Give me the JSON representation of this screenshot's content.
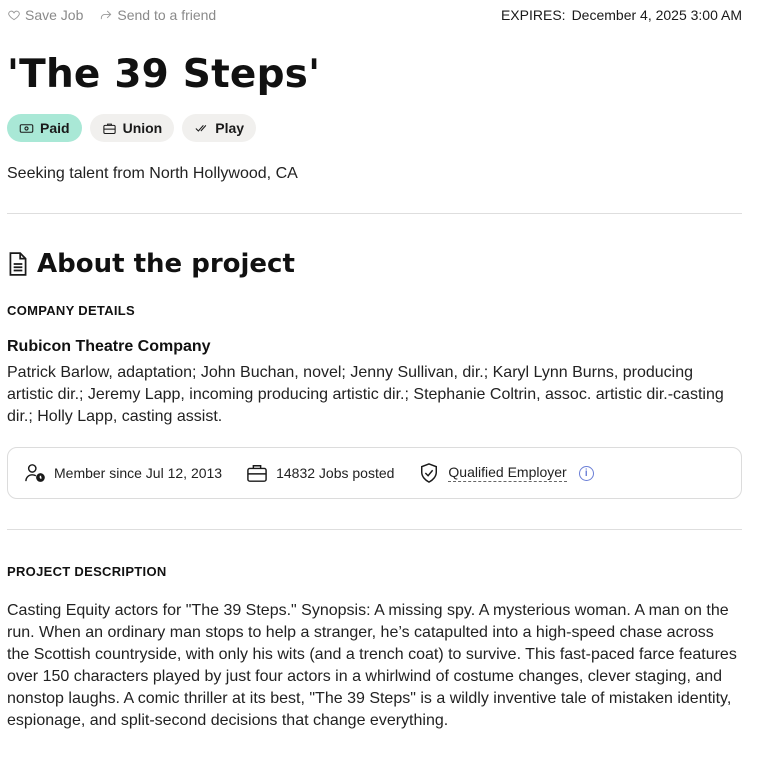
{
  "topbar": {
    "save_job": "Save Job",
    "send_friend": "Send to a friend",
    "expires_label": "EXPIRES:",
    "expires_value": "December 4, 2025 3:00 AM"
  },
  "title": "'The 39 Steps'",
  "tags": [
    {
      "label": "Paid",
      "icon": "cash-icon"
    },
    {
      "label": "Union",
      "icon": "briefcase-icon"
    },
    {
      "label": "Play",
      "icon": "check-icon"
    }
  ],
  "seeking": "Seeking talent from North Hollywood, CA",
  "about": {
    "heading": "About the project",
    "company_details_label": "COMPANY DETAILS",
    "company_name": "Rubicon Theatre Company",
    "company_text": "Patrick Barlow, adaptation; John Buchan, novel; Jenny Sullivan, dir.; Karyl Lynn Burns, producing artistic dir.; Jeremy Lapp, incoming producing artistic dir.; Stephanie Coltrin, assoc. artistic dir.-casting dir.; Holly Lapp, casting assist.",
    "stats": {
      "member_since": "Member since Jul 12, 2013",
      "jobs_posted": "14832 Jobs posted",
      "qualified": "Qualified Employer"
    }
  },
  "project_description": {
    "label": "PROJECT DESCRIPTION",
    "text": "Casting Equity actors for \"The 39 Steps.\" Synopsis: A missing spy. A mysterious woman. A man on the run. When an ordinary man stops to help a stranger, he’s catapulted into a high-speed chase across the Scottish countryside, with only his wits (and a trench coat) to survive. This fast-paced farce features over 150 characters played by just four actors in a whirlwind of costume changes, clever staging, and nonstop laughs. A comic thriller at its best, \"The 39 Steps\" is a wildly inventive tale of mistaken identity, espionage, and split-second decisions that change everything."
  },
  "colors": {
    "paid_tag": "#a9e8d6",
    "tag_bg": "#f1f0ee",
    "info_accent": "#6b7fd6"
  }
}
